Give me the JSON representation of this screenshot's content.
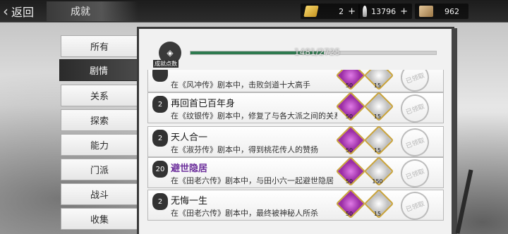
{
  "topbar": {
    "back_label": "返回",
    "title": "成就"
  },
  "resources": [
    {
      "icon": "gold-ingot-icon",
      "value": "2"
    },
    {
      "icon": "silver-ingot-icon",
      "value": "13796"
    },
    {
      "icon": "scroll-icon",
      "value": "962"
    }
  ],
  "tabs": [
    "所有",
    "剧情",
    "关系",
    "探索",
    "能力",
    "门派",
    "战斗",
    "收集"
  ],
  "active_tab": "剧情",
  "progress": {
    "label": "成就点数",
    "text": "1481/2725",
    "fraction": 0.5435
  },
  "achievements": [
    {
      "rank": "",
      "name": "",
      "desc": "在《风冲传》剧本中，击败剑道十大高手",
      "reward1": "50",
      "reward2": "15",
      "claimed": "已领取"
    },
    {
      "rank": "2",
      "name": "再回首已百年身",
      "desc": "在《纹银传》剧本中，修复了与各大派之间的关系",
      "reward1": "50",
      "reward2": "15",
      "claimed": "已领取"
    },
    {
      "rank": "2",
      "name": "天人合一",
      "desc": "在《淑芬传》剧本中，得到桃花传人的赞扬",
      "reward1": "50",
      "reward2": "15",
      "claimed": "已领取"
    },
    {
      "rank": "20",
      "name": "避世隐居",
      "desc": "在《田老六传》剧本中，与田小六一起避世隐居",
      "reward1": "50",
      "reward2": "150",
      "claimed": "已领取"
    },
    {
      "rank": "2",
      "name": "无悔一生",
      "desc": "在《田老六传》剧本中，最终被神秘人所杀",
      "reward1": "50",
      "reward2": "15",
      "claimed": "已领取"
    }
  ]
}
